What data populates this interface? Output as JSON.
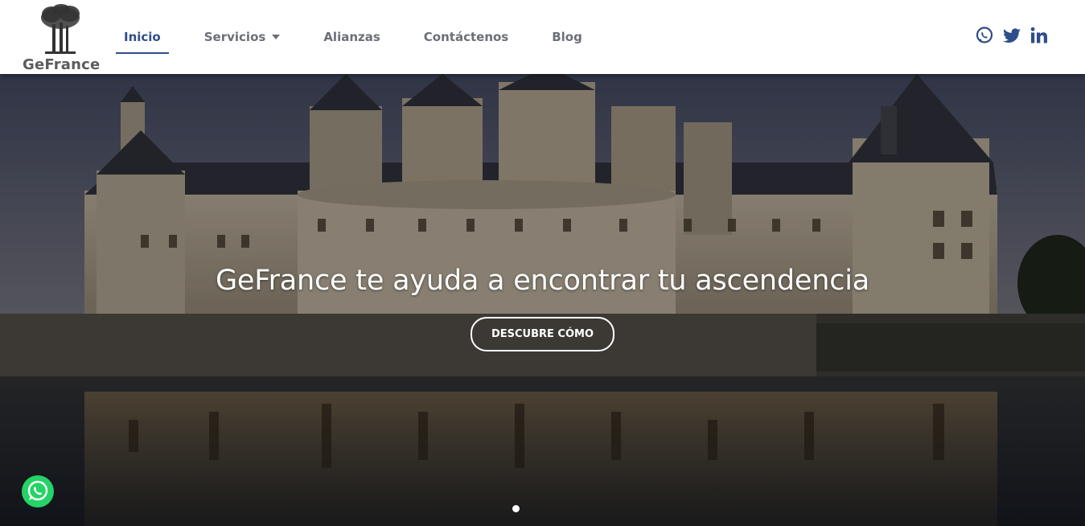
{
  "brand": {
    "name": "GeFrance"
  },
  "nav": {
    "items": [
      {
        "label": "Inicio",
        "active": true
      },
      {
        "label": "Servicios",
        "has_dropdown": true
      },
      {
        "label": "Alianzas"
      },
      {
        "label": "Contáctenos"
      },
      {
        "label": "Blog"
      }
    ]
  },
  "social": [
    "whatsapp-icon",
    "twitter-icon",
    "linkedin-icon"
  ],
  "hero": {
    "title": "GeFrance te ayuda a encontrar tu ascendencia",
    "cta_label": "DESCUBRE CÓMO"
  },
  "colors": {
    "accent": "#2f4d8a",
    "nav_text": "#6b6f76",
    "whatsapp": "#25d366"
  }
}
